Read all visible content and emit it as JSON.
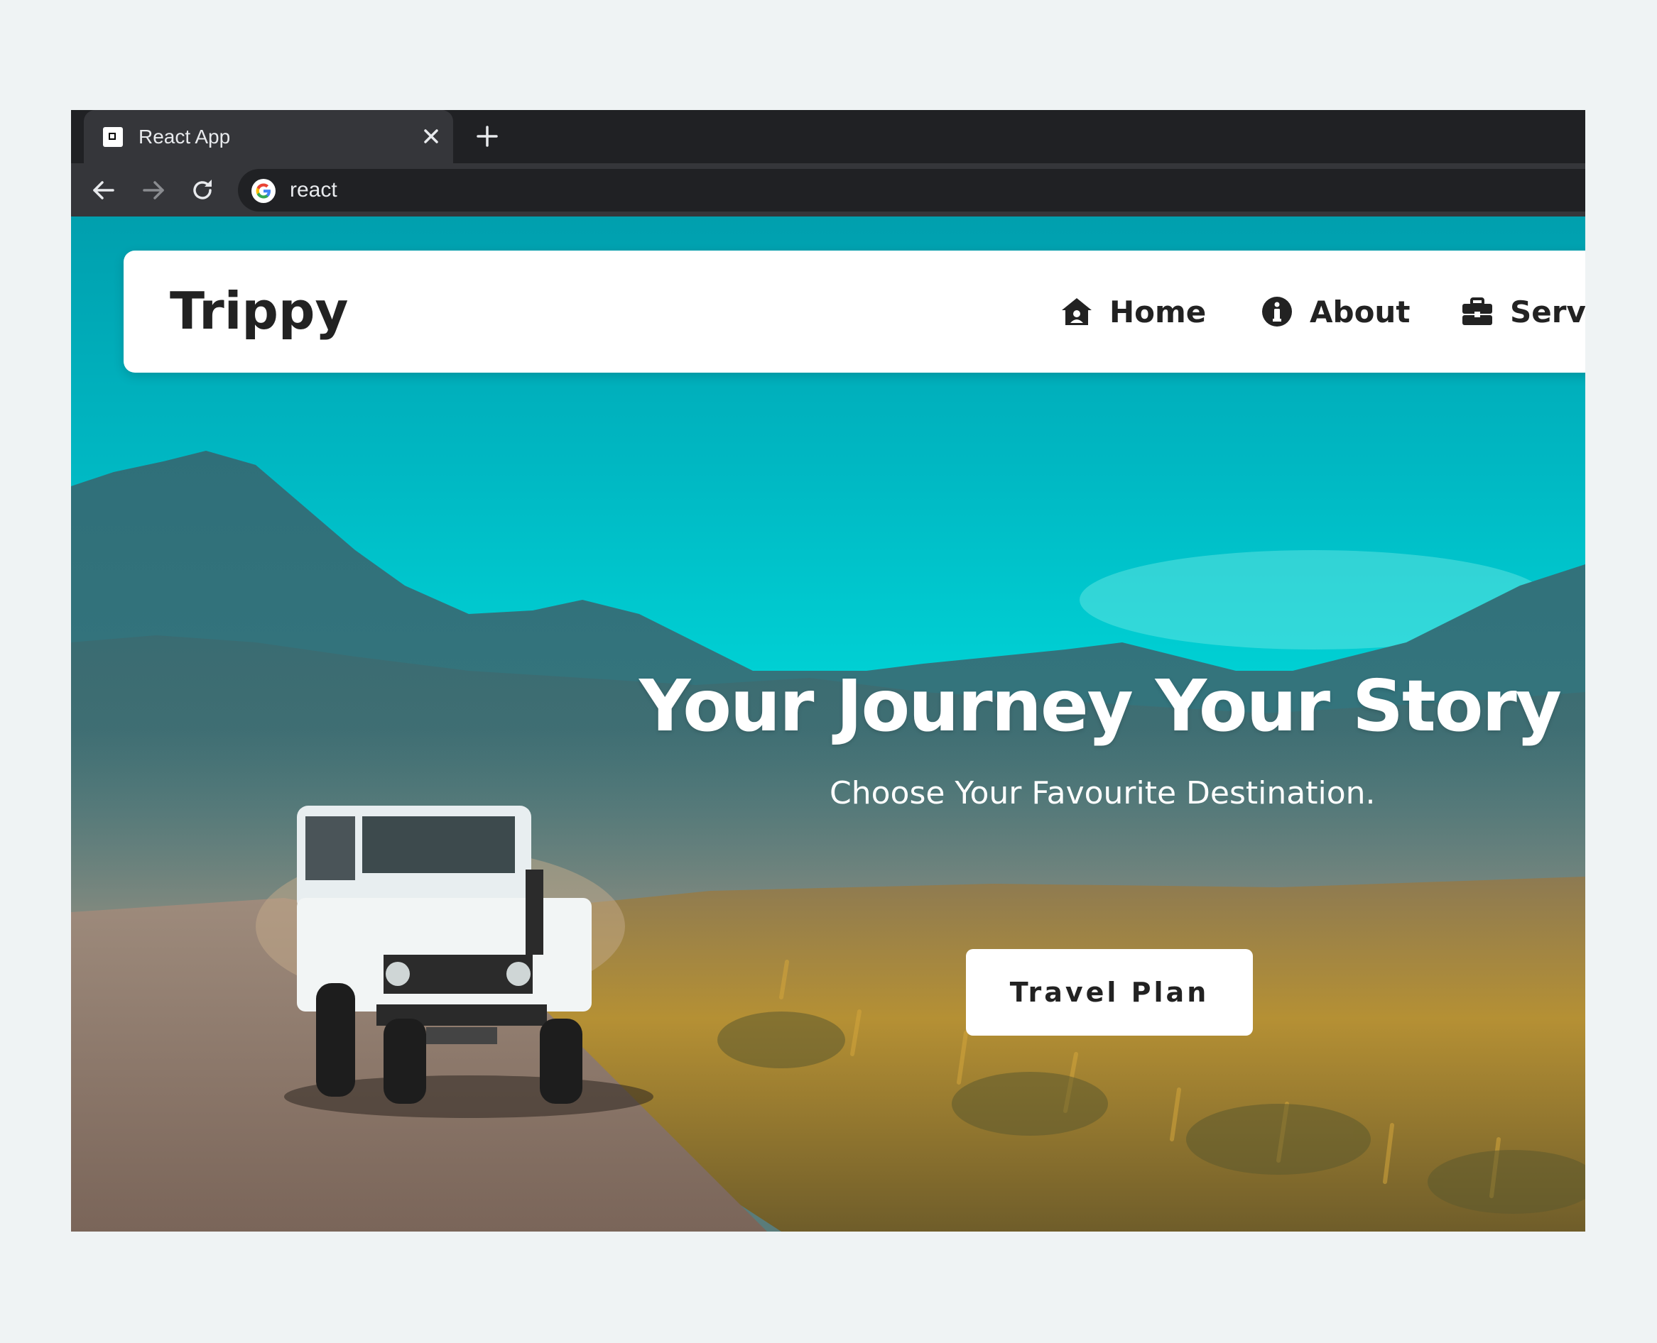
{
  "browser": {
    "tab": {
      "title": "React App",
      "close_icon": "close-icon",
      "favicon": "react-app-favicon"
    },
    "new_tab_icon": "plus-icon",
    "toolbar": {
      "back_icon": "arrow-left-icon",
      "forward_icon": "arrow-right-icon",
      "reload_icon": "reload-icon",
      "search_engine_icon": "google-g-icon",
      "url": "react"
    }
  },
  "page": {
    "navbar": {
      "logo": "Trippy",
      "items": [
        {
          "label": "Home",
          "icon": "house-user-icon"
        },
        {
          "label": "About",
          "icon": "info-circle-icon"
        },
        {
          "label": "Servi",
          "icon": "briefcase-icon"
        }
      ]
    },
    "hero": {
      "title": "Your Journey Your Story",
      "subtitle": "Choose Your Favourite Destination.",
      "cta_label": "Travel Plan",
      "background": "jeep-on-dirt-road-with-mountains-and-turquoise-sky"
    }
  },
  "colors": {
    "sky": "#00d4d8",
    "chrome_dark": "#202124",
    "chrome_tab": "#35363a",
    "navbar_bg": "#ffffff",
    "text_dark": "#222222",
    "page_bg": "#eff3f4"
  }
}
